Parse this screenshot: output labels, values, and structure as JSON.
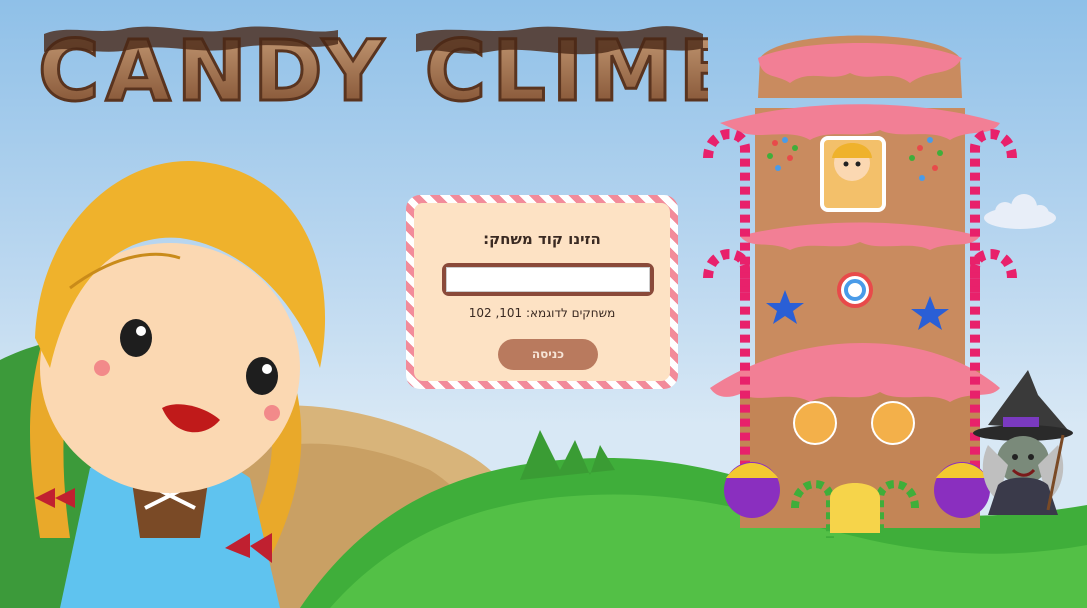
{
  "game": {
    "title": "CANDY CLIMB"
  },
  "login": {
    "prompt": "הזינו קוד משחק:",
    "code_value": "",
    "hint": "משחקים לדוגמא: 101, 102",
    "enter_label": "כניסה"
  },
  "icons": [
    "girl-character",
    "gingerbread-tower",
    "witch-character",
    "cloud",
    "lollipop-icon",
    "star-candy-icon",
    "candy-cane-icon"
  ],
  "colors": {
    "sky": "#8fc0e8",
    "card_stripe": "#f28b9a",
    "card_bg": "#fde2c4",
    "button": "#b97a5e",
    "grass": "#3fae3a",
    "tower_wall": "#c98b5f",
    "frosting": "#f27f95"
  }
}
